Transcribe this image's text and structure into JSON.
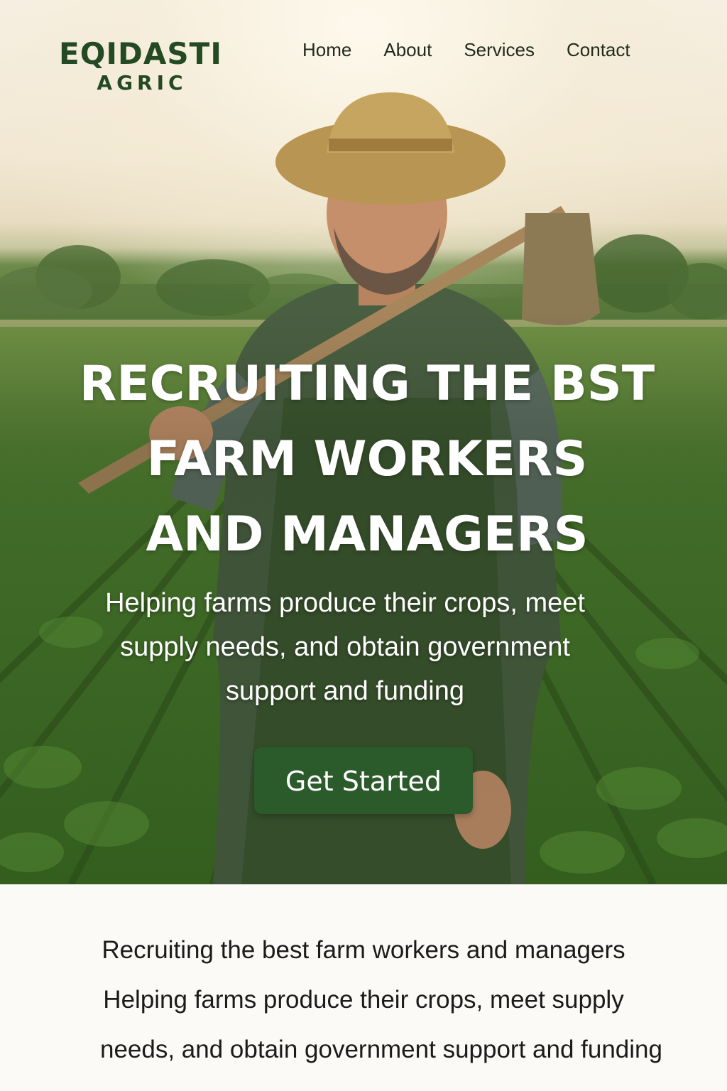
{
  "brand": {
    "name": "EQIDASTI",
    "subtitle": "AGRIC"
  },
  "nav": {
    "items": [
      "Home",
      "About",
      "Services",
      "Contact"
    ]
  },
  "hero": {
    "headline_lines": [
      "RECRUITING THE BST",
      "FARM WORKERS",
      "AND MANAGERS"
    ],
    "subheadline_lines": [
      "Helping farms produce their crops, meet",
      "supply needs, and obtain government",
      "support and funding"
    ],
    "cta_label": "Get Started",
    "image": "farmer-with-hoe-in-field"
  },
  "intro": {
    "lines": [
      "Recruiting the best farm workers and managers",
      "Helping farms produce their crops, meet supply",
      "needs, and obtain government support and funding"
    ]
  },
  "colors": {
    "brand_green": "#234a22",
    "button_green": "#2b5a2b",
    "background": "#fcfaf7"
  }
}
